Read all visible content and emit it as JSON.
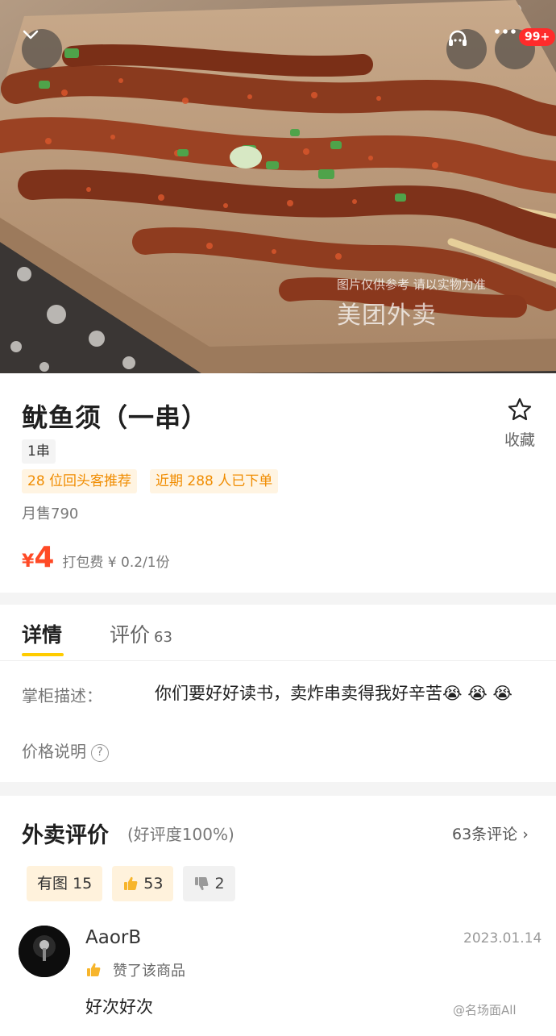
{
  "header": {
    "watermark_text": "图片仅供参考 请以实物为准",
    "brand_text": "美团外卖",
    "badge": "99+"
  },
  "product": {
    "name": "鱿鱼须（一串）",
    "favorite_label": "收藏",
    "spec": "1串",
    "tags": [
      "28 位回头客推荐",
      "近期 288 人已下单"
    ],
    "monthly_sales": "月售790",
    "price_symbol": "¥",
    "price": "4",
    "packing_fee": "打包费 ¥ 0.2/1份"
  },
  "tabs": {
    "detail_label": "详情",
    "review_label": "评价",
    "review_count": "63"
  },
  "detail": {
    "desc_label": "掌柜描述：",
    "desc_text": "你们要好好读书，卖炸串卖得我好辛苦😭 😭 😭",
    "price_note_label": "价格说明",
    "help_glyph": "?"
  },
  "reviews": {
    "title": "外卖评价",
    "rating": "(好评度100%)",
    "more_link": "63条评论 ›",
    "filters": {
      "pictures_label": "有图",
      "pictures_count": "15",
      "up_count": "53",
      "down_count": "2"
    },
    "items": [
      {
        "user": "AaorB",
        "date": "2023.01.14",
        "action": "赞了该商品",
        "text": "好次好次"
      }
    ]
  },
  "footer": {
    "weibo_mark": "@名场面All"
  },
  "colors": {
    "accent_price": "#ff4a26",
    "tag_text": "#f08c00",
    "tab_underline": "#ffcc00",
    "badge": "#ff2b2b"
  },
  "icons": [
    "chevron-down-icon",
    "customer-service-icon",
    "more-icon",
    "star-icon",
    "thumbs-up-icon",
    "thumbs-down-icon",
    "help-icon",
    "chevron-right-icon"
  ]
}
